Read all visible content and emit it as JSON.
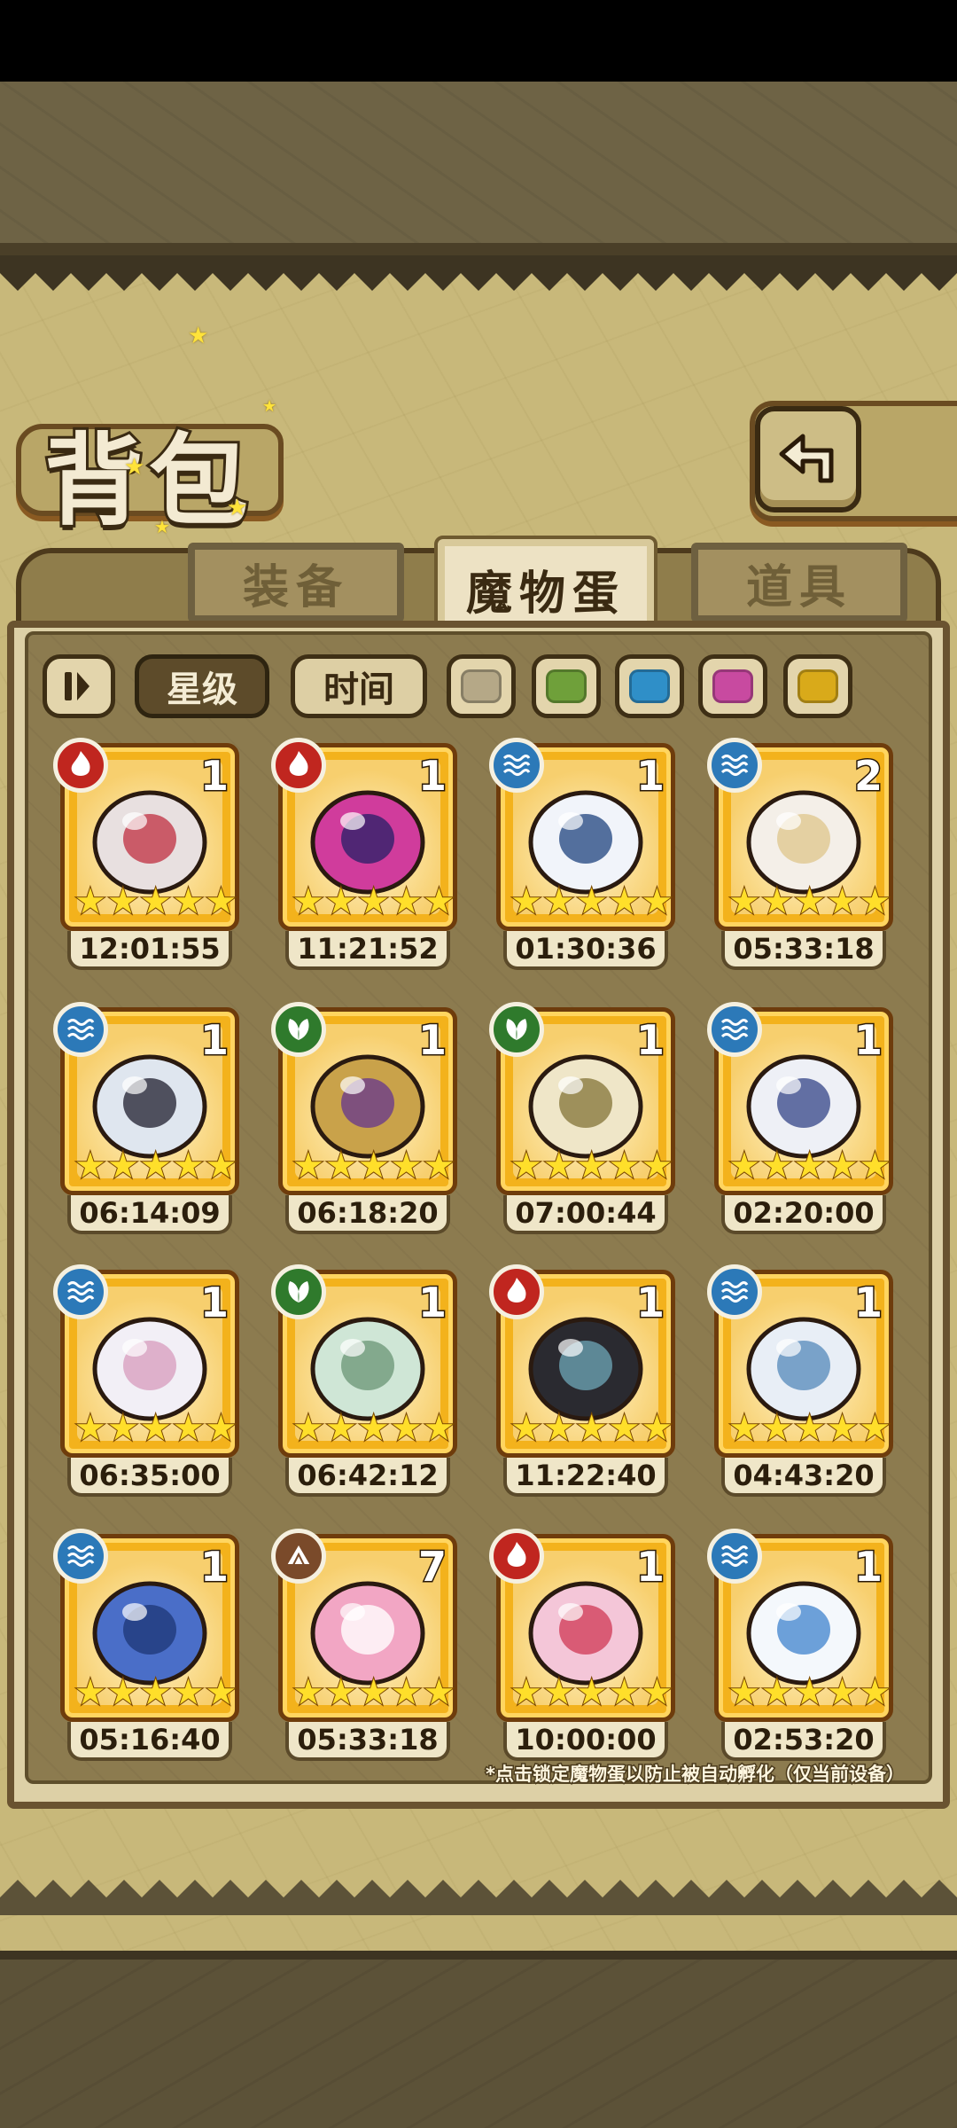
{
  "header": {
    "title": "背包"
  },
  "tabs": [
    {
      "label": "装备",
      "active": false
    },
    {
      "label": "魔物蛋",
      "active": true
    },
    {
      "label": "道具",
      "active": false
    }
  ],
  "filters": {
    "sort_order_icon": "sort-order-icon",
    "star_label": "星级",
    "time_label": "时间",
    "colors": [
      "#b5a887",
      "#6fa03a",
      "#2f8fc8",
      "#c84aa0",
      "#d9aa1a"
    ]
  },
  "element_colors": {
    "fire": "#c0261f",
    "water": "#2c79b8",
    "nature": "#2f7a2c",
    "earth": "#7a4a2a"
  },
  "eggs": [
    {
      "count": "1",
      "element": "fire",
      "timer": "12:01:55",
      "stars": "★★★★★"
    },
    {
      "count": "1",
      "element": "fire",
      "timer": "11:21:52",
      "stars": "★★★★★"
    },
    {
      "count": "1",
      "element": "water",
      "timer": "01:30:36",
      "stars": "★★★★★"
    },
    {
      "count": "2",
      "element": "water",
      "timer": "05:33:18",
      "stars": "★★★★★"
    },
    {
      "count": "1",
      "element": "water",
      "timer": "06:14:09",
      "stars": "★★★★★"
    },
    {
      "count": "1",
      "element": "nature",
      "timer": "06:18:20",
      "stars": "★★★★★"
    },
    {
      "count": "1",
      "element": "nature",
      "timer": "07:00:44",
      "stars": "★★★★★"
    },
    {
      "count": "1",
      "element": "water",
      "timer": "02:20:00",
      "stars": "★★★★★"
    },
    {
      "count": "1",
      "element": "water",
      "timer": "06:35:00",
      "stars": "★★★★★"
    },
    {
      "count": "1",
      "element": "nature",
      "timer": "06:42:12",
      "stars": "★★★★★"
    },
    {
      "count": "1",
      "element": "fire",
      "timer": "11:22:40",
      "stars": "★★★★★"
    },
    {
      "count": "1",
      "element": "water",
      "timer": "04:43:20",
      "stars": "★★★★★"
    },
    {
      "count": "1",
      "element": "water",
      "timer": "05:16:40",
      "stars": "★★★★★"
    },
    {
      "count": "7",
      "element": "earth",
      "timer": "05:33:18",
      "stars": "★★★★★"
    },
    {
      "count": "1",
      "element": "fire",
      "timer": "10:00:00",
      "stars": "★★★★★"
    },
    {
      "count": "1",
      "element": "water",
      "timer": "02:53:20",
      "stars": "★★★★★"
    }
  ],
  "footnote": "*点击锁定魔物蛋以防止被自动孵化（仅当前设备）"
}
